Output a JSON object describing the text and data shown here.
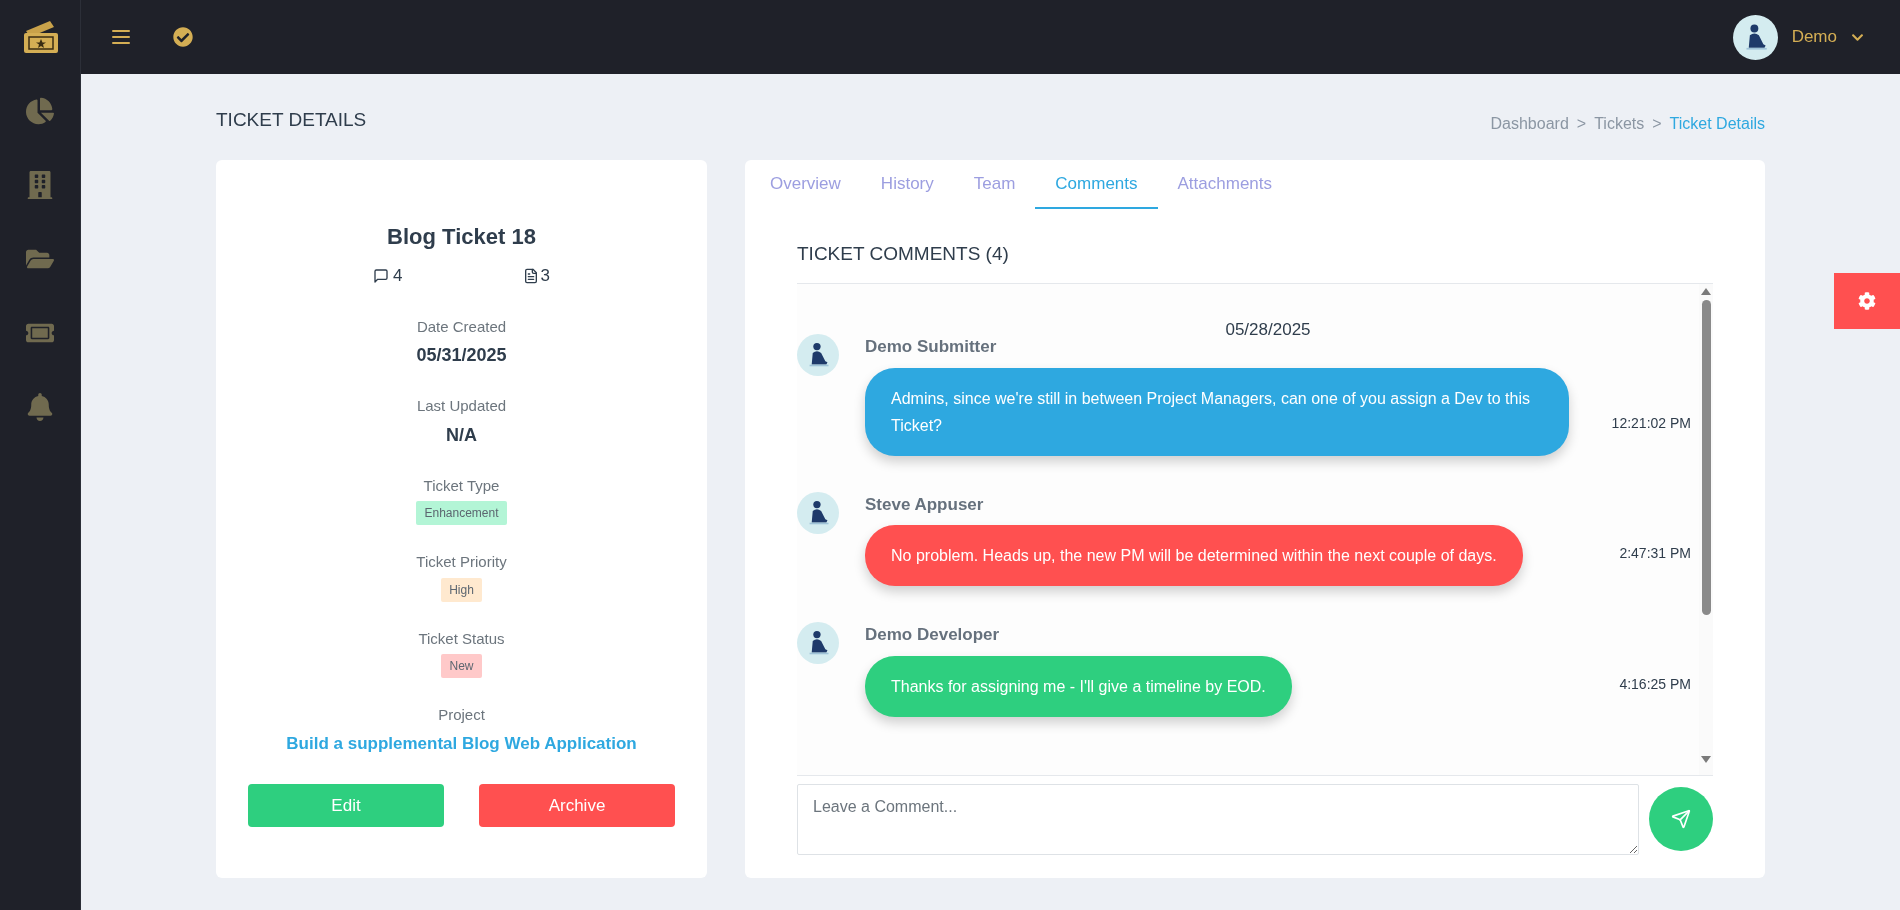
{
  "header": {
    "user": {
      "name": "Demo"
    }
  },
  "page": {
    "title": "TICKET DETAILS",
    "breadcrumbs": [
      {
        "label": "Dashboard",
        "selected": false,
        "separator": ">"
      },
      {
        "label": "Tickets",
        "selected": false,
        "separator": ">"
      },
      {
        "label": "Ticket Details",
        "selected": true
      }
    ]
  },
  "ticket": {
    "title": "Blog Ticket 18",
    "comment_count": "4",
    "attachment_count": "3",
    "fields": [
      {
        "label": "Date Created",
        "value": "05/31/2025",
        "kind": "text"
      },
      {
        "label": "Last Updated",
        "value": "N/A",
        "kind": "text"
      },
      {
        "label": "Ticket Type",
        "value": "Enhancement",
        "kind": "badge",
        "color": "#b3f5d6"
      },
      {
        "label": "Ticket Priority",
        "value": "High",
        "kind": "badge",
        "color": "#ffe9cf"
      },
      {
        "label": "Ticket Status",
        "value": "New",
        "kind": "badge",
        "color": "#ffc9c9"
      },
      {
        "label": "Project",
        "value": "Build a supplemental Blog Web Application",
        "kind": "link"
      }
    ],
    "buttons": [
      {
        "label": "Edit",
        "color": "#2ecf7f"
      },
      {
        "label": "Archive",
        "color": "#ff5050"
      }
    ]
  },
  "tabs": [
    {
      "label": "Overview",
      "selected": false
    },
    {
      "label": "History",
      "selected": false
    },
    {
      "label": "Team",
      "selected": false
    },
    {
      "label": "Comments",
      "selected": true
    },
    {
      "label": "Attachments",
      "selected": false
    }
  ],
  "comments": {
    "title": "TICKET COMMENTS (4)",
    "date": "05/28/2025",
    "items": [
      {
        "author": "Demo Submitter",
        "text": "Admins, since we're still in between Project Managers, can one of you assign a Dev to this Ticket?",
        "time": "12:21:02 PM",
        "color": "#2ea8e0"
      },
      {
        "author": "Steve Appuser",
        "text": "No problem. Heads up, the new PM will be determined within the next couple of days.",
        "time": "2:47:31 PM",
        "color": "#ff5050"
      },
      {
        "author": "Demo Developer",
        "text": "Thanks for assigning me - I'll give a timeline by EOD.",
        "time": "4:16:25 PM",
        "color": "#2ecf7f"
      }
    ],
    "input": {
      "placeholder": "Leave a Comment..."
    }
  }
}
